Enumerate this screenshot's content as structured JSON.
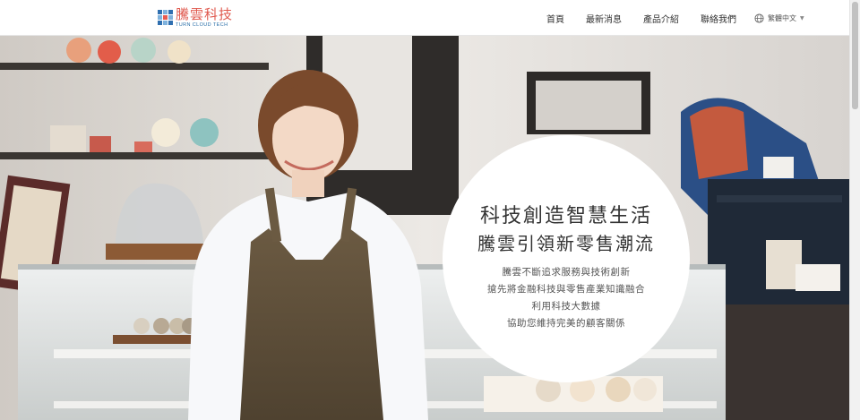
{
  "brand": {
    "name_cn": "騰雲科技",
    "name_en": "TURN CLOUD TECH",
    "colors": [
      "#e85a4f",
      "#2f6fb0",
      "#7fb2dd"
    ]
  },
  "nav": {
    "items": [
      {
        "label": "首頁"
      },
      {
        "label": "最新消息"
      },
      {
        "label": "產品介紹"
      },
      {
        "label": "聯絡我們"
      }
    ],
    "language": {
      "label": "繁體中文",
      "icon": "globe-icon",
      "caret": "▼"
    }
  },
  "hero": {
    "headline_1": "科技創造智慧生活",
    "headline_2": "騰雲引領新零售潮流",
    "lines": [
      "騰雲不斷追求服務與技術創新",
      "搶先將金融科技與零售產業知識融合",
      "利用科技大數據",
      "協助您維持完美的顧客關係"
    ]
  }
}
